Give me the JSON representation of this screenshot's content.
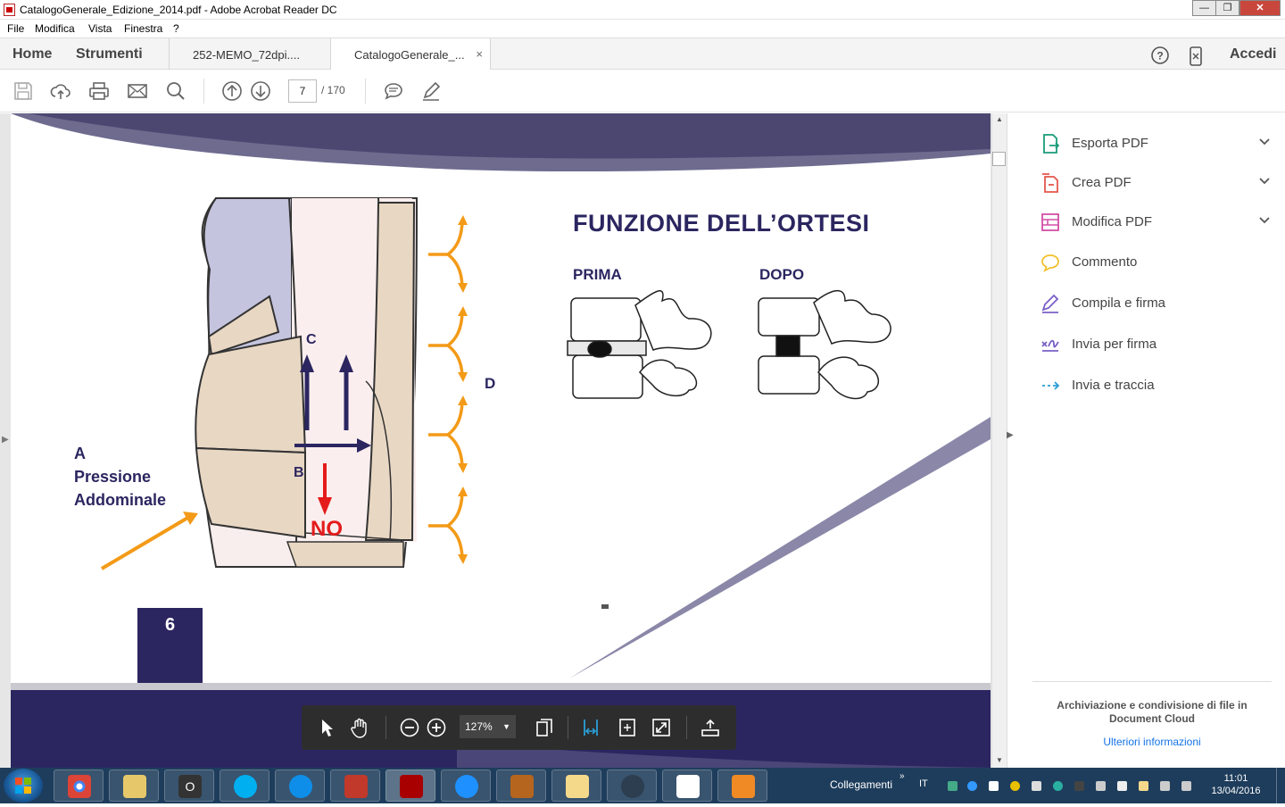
{
  "window": {
    "title": "CatalogoGenerale_Edizione_2014.pdf - Adobe Acrobat Reader DC",
    "min": "—",
    "max": "❐",
    "close": "✕"
  },
  "menu": [
    "File",
    "Modifica",
    "Vista",
    "Finestra",
    "?"
  ],
  "nav": {
    "home": "Home",
    "tools": "Strumenti",
    "signin": "Accedi"
  },
  "tabs": [
    {
      "label": "252-MEMO_72dpi...."
    },
    {
      "label": "CatalogoGenerale_...",
      "close": "×"
    }
  ],
  "toolbar": {
    "page_current": "7",
    "page_total": "/ 170"
  },
  "doc": {
    "heading": "FUNZIONE DELL’ORTESI",
    "before": "PRIMA",
    "after": "DOPO",
    "label_a": "A",
    "label_a_line1": "Pressione",
    "label_a_line2": "Addominale",
    "label_b": "B",
    "label_c": "C",
    "label_d": "D",
    "label_no": "NO",
    "page_number": "6"
  },
  "right_pane": {
    "tools": [
      {
        "label": "Esporta PDF",
        "icon": "export-pdf-icon",
        "color": "#1a9c7a",
        "expand": true
      },
      {
        "label": "Crea PDF",
        "icon": "create-pdf-icon",
        "color": "#e4574c",
        "expand": true
      },
      {
        "label": "Modifica PDF",
        "icon": "edit-pdf-icon",
        "color": "#d24fa6",
        "expand": true
      },
      {
        "label": "Commento",
        "icon": "comment-icon",
        "color": "#f2c12e",
        "expand": false
      },
      {
        "label": "Compila e firma",
        "icon": "fill-sign-icon",
        "color": "#7a5fc7",
        "expand": false
      },
      {
        "label": "Invia per firma",
        "icon": "send-sign-icon",
        "color": "#7a5fc7",
        "expand": false
      },
      {
        "label": "Invia e traccia",
        "icon": "send-track-icon",
        "color": "#2a9fd6",
        "expand": false
      }
    ],
    "cloud_text": "Archiviazione e condivisione di file in Document Cloud",
    "cloud_link": "Ulteriori informazioni"
  },
  "float_toolbar": {
    "zoom": "127%"
  },
  "taskbar": {
    "links": "Collegamenti",
    "lang": "IT",
    "time": "11:01",
    "date": "13/04/2016"
  }
}
